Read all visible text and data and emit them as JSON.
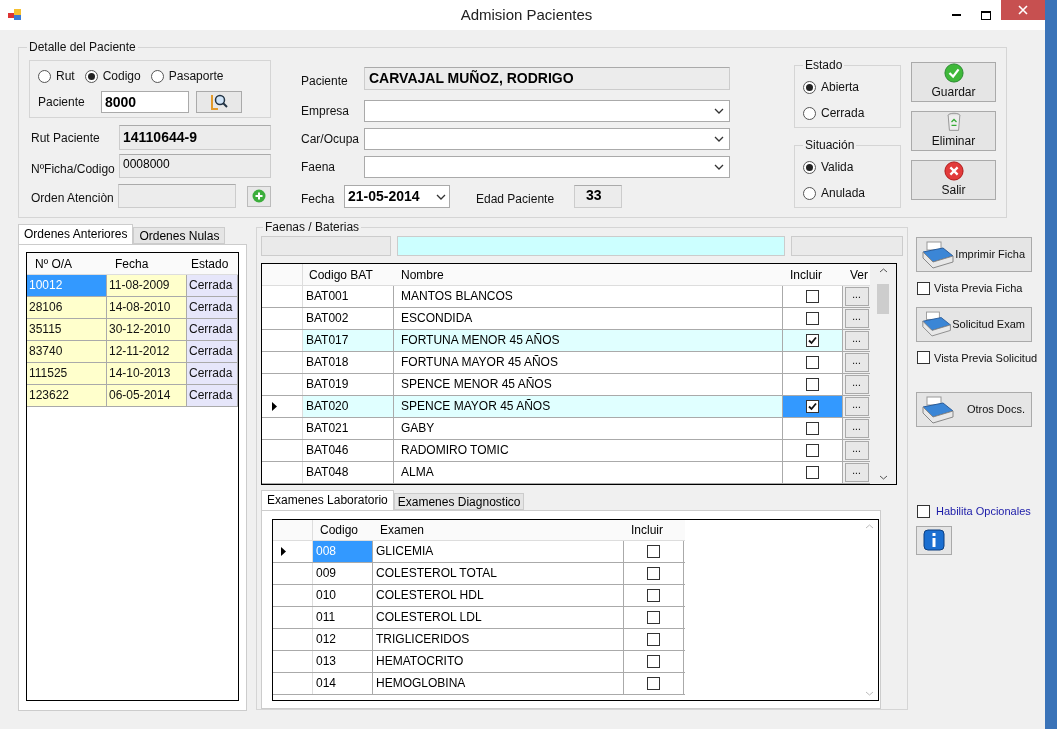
{
  "window": {
    "title": "Admision Pacientes"
  },
  "patient_detail": {
    "title": "Detalle del Paciente",
    "search_by": [
      {
        "label": "Rut",
        "selected": false
      },
      {
        "label": "Codigo",
        "selected": true
      },
      {
        "label": "Pasaporte",
        "selected": false
      }
    ],
    "patient_field": {
      "label": "Paciente",
      "value": "8000"
    },
    "rut": {
      "label": "Rut Paciente",
      "value": "14110644-9"
    },
    "ficha": {
      "label": "NºFicha/Codigo",
      "value": "0008000"
    },
    "orden": {
      "label": "Orden Atenciòn"
    },
    "patient_name": {
      "label": "Paciente",
      "value": "CARVAJAL MUÑOZ, RODRIGO"
    },
    "combos": [
      {
        "label": "Empresa"
      },
      {
        "label": "Car/Ocupa"
      },
      {
        "label": "Faena"
      }
    ],
    "fecha": {
      "label": "Fecha",
      "value": "21-05-2014"
    },
    "edad": {
      "label": "Edad Paciente",
      "value": "33"
    },
    "estado": {
      "title": "Estado",
      "options": [
        {
          "label": "Abierta",
          "selected": true
        },
        {
          "label": "Cerrada",
          "selected": false
        }
      ]
    },
    "situacion": {
      "title": "Situación",
      "options": [
        {
          "label": "Valida",
          "selected": true
        },
        {
          "label": "Anulada",
          "selected": false
        }
      ]
    }
  },
  "actions": [
    {
      "kind": "save",
      "label": "Guardar"
    },
    {
      "kind": "delete",
      "label": "Eliminar"
    },
    {
      "kind": "exit",
      "label": "Salir"
    }
  ],
  "orders": {
    "tabs": [
      {
        "label": "Ordenes Anteriores",
        "selected": true
      },
      {
        "label": "Ordenes Nulas",
        "selected": false
      }
    ],
    "columns": [
      "Nº O/A",
      "Fecha",
      "Estado"
    ],
    "rows": [
      {
        "cells": [
          "10012",
          "11-08-2009",
          "Cerrada"
        ],
        "selected": true
      },
      {
        "cells": [
          "28106",
          "14-08-2010",
          "Cerrada"
        ],
        "selected": false
      },
      {
        "cells": [
          "35115",
          "30-12-2010",
          "Cerrada"
        ],
        "selected": false
      },
      {
        "cells": [
          "83740",
          "12-11-2012",
          "Cerrada"
        ],
        "selected": false
      },
      {
        "cells": [
          "111525",
          "14-10-2013",
          "Cerrada"
        ],
        "selected": false
      },
      {
        "cells": [
          "123622",
          "06-05-2014",
          "Cerrada"
        ],
        "selected": false
      }
    ]
  },
  "faenas": {
    "title": "Faenas / Baterias",
    "columns": [
      "Codigo BAT",
      "Nombre",
      "Incluir",
      "Ver"
    ],
    "rows": [
      {
        "code": "BAT001",
        "name": "MANTOS BLANCOS",
        "checked": false,
        "selected": false,
        "ver": "..."
      },
      {
        "code": "BAT002",
        "name": "ESCONDIDA",
        "checked": false,
        "selected": false,
        "ver": "..."
      },
      {
        "code": "BAT017",
        "name": "FORTUNA MENOR 45 AÑOS",
        "checked": true,
        "selected": false,
        "ver": "..."
      },
      {
        "code": "BAT018",
        "name": "FORTUNA MAYOR 45 AÑOS",
        "checked": false,
        "selected": false,
        "ver": "..."
      },
      {
        "code": "BAT019",
        "name": "SPENCE MENOR 45 AÑOS",
        "checked": false,
        "selected": false,
        "ver": "..."
      },
      {
        "code": "BAT020",
        "name": "SPENCE MAYOR 45 AÑOS",
        "checked": true,
        "selected": true,
        "ver": "..."
      },
      {
        "code": "BAT021",
        "name": "GABY",
        "checked": false,
        "selected": false,
        "ver": "..."
      },
      {
        "code": "BAT046",
        "name": "RADOMIRO TOMIC",
        "checked": false,
        "selected": false,
        "ver": "..."
      },
      {
        "code": "BAT048",
        "name": "ALMA",
        "checked": false,
        "selected": false,
        "ver": "..."
      }
    ]
  },
  "exams": {
    "tabs": [
      {
        "label": "Examenes Laboratorio",
        "selected": true
      },
      {
        "label": "Examenes Diagnostico",
        "selected": false
      }
    ],
    "columns": [
      "Codigo",
      "Examen",
      "Incluir"
    ],
    "rows": [
      {
        "code": "008",
        "name": "GLICEMIA",
        "checked": false,
        "selected": true
      },
      {
        "code": "009",
        "name": "COLESTEROL TOTAL",
        "checked": false,
        "selected": false
      },
      {
        "code": "010",
        "name": "COLESTEROL HDL",
        "checked": false,
        "selected": false
      },
      {
        "code": "011",
        "name": "COLESTEROL LDL",
        "checked": false,
        "selected": false
      },
      {
        "code": "012",
        "name": "TRIGLICERIDOS",
        "checked": false,
        "selected": false
      },
      {
        "code": "013",
        "name": "HEMATOCRITO",
        "checked": false,
        "selected": false
      },
      {
        "code": "014",
        "name": "HEMOGLOBINA",
        "checked": false,
        "selected": false
      }
    ]
  },
  "print_panel": [
    {
      "kind": "button",
      "label": "Imprimir Ficha"
    },
    {
      "kind": "checkbox",
      "label": "Vista Previa Ficha",
      "checked": false
    },
    {
      "kind": "button",
      "label": "Solicitud Exam"
    },
    {
      "kind": "checkbox",
      "label": "Vista Previa Solicitud",
      "checked": false
    },
    {
      "kind": "button",
      "label": "Otros Docs."
    }
  ],
  "optionals": {
    "label": "Habilita Opcionales",
    "checked": false
  }
}
